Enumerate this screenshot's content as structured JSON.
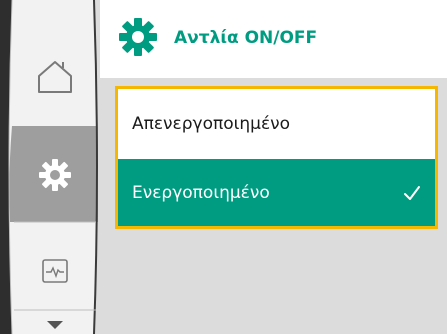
{
  "header": {
    "title": "Αντλία ON/OFF",
    "icon": "gear-icon"
  },
  "sidebar": {
    "items": [
      {
        "icon": "home-icon"
      },
      {
        "icon": "gear-icon",
        "active": true
      },
      {
        "icon": "monitor-icon"
      },
      {
        "icon": "chevron-down-icon"
      }
    ]
  },
  "options": [
    {
      "label": "Απενεργοποιημένο",
      "selected": false
    },
    {
      "label": "Ενεργοποιημένο",
      "selected": true,
      "icon": "check-icon"
    }
  ],
  "colors": {
    "accent": "#009c82",
    "focus": "#f5b700",
    "background": "#dcdcdc"
  }
}
